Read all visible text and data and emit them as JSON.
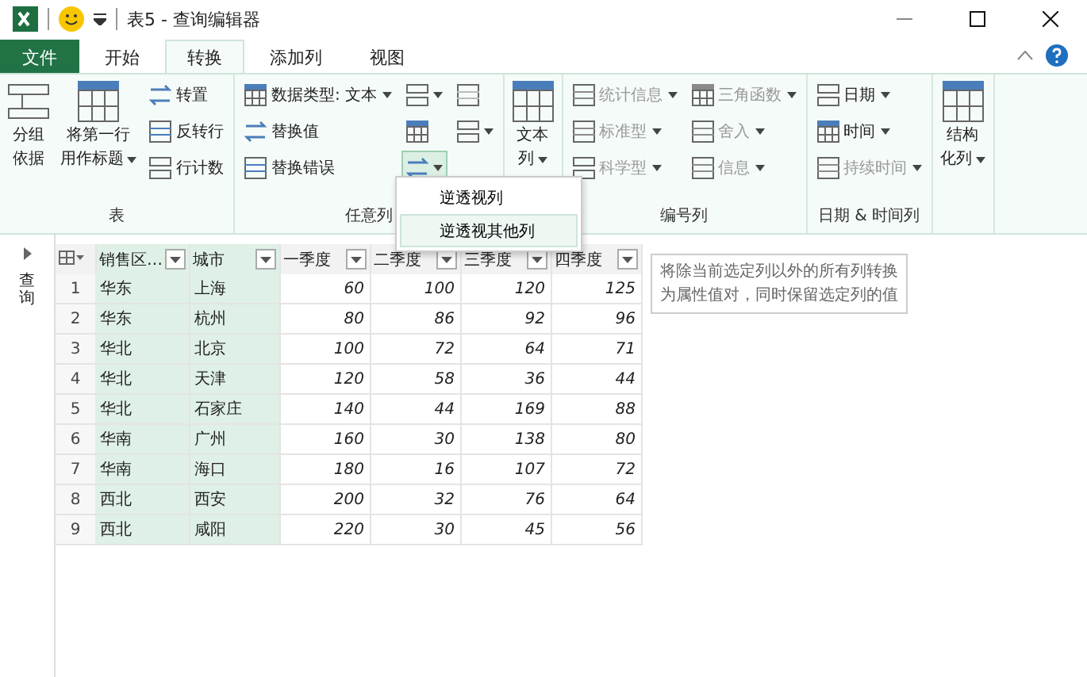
{
  "window": {
    "title": "表5 - 查询编辑器"
  },
  "tabs": [
    {
      "label": "文件",
      "kind": "file",
      "selected": false
    },
    {
      "label": "开始",
      "kind": "tab",
      "selected": false
    },
    {
      "label": "转换",
      "kind": "tab",
      "selected": true
    },
    {
      "label": "添加列",
      "kind": "tab",
      "selected": false
    },
    {
      "label": "视图",
      "kind": "tab",
      "selected": false
    }
  ],
  "ribbon": {
    "groups": [
      {
        "label": "表",
        "columns": [
          [
            {
              "kind": "large",
              "lines": [
                "分组",
                "依据"
              ],
              "dropdown": false,
              "disabled": false
            }
          ],
          [
            {
              "kind": "large",
              "lines": [
                "将第一行",
                "用作标题"
              ],
              "dropdown": true,
              "disabled": false
            }
          ],
          [
            {
              "kind": "small",
              "label": "转置",
              "dropdown": false,
              "disabled": false
            },
            {
              "kind": "small",
              "label": "反转行",
              "dropdown": false,
              "disabled": false
            },
            {
              "kind": "small",
              "label": "行计数",
              "dropdown": false,
              "disabled": false
            }
          ]
        ]
      },
      {
        "label": "任意列",
        "columns": [
          [
            {
              "kind": "small",
              "label": "数据类型: 文本",
              "dropdown": true,
              "disabled": false
            },
            {
              "kind": "small",
              "label": "替换值",
              "dropdown": false,
              "disabled": false
            },
            {
              "kind": "small",
              "label": "替换错误",
              "dropdown": false,
              "disabled": false
            }
          ],
          [
            {
              "kind": "icon",
              "dropdown": true,
              "disabled": false,
              "pressed": false
            },
            {
              "kind": "icon",
              "dropdown": false,
              "disabled": false,
              "pressed": false
            },
            {
              "kind": "icon",
              "dropdown": true,
              "disabled": false,
              "pressed": true
            }
          ],
          [
            {
              "kind": "icon",
              "dropdown": false,
              "disabled": true,
              "pressed": false
            },
            {
              "kind": "icon",
              "dropdown": true,
              "disabled": false,
              "pressed": false
            }
          ]
        ]
      },
      {
        "columns": [
          [
            {
              "kind": "large",
              "lines": [
                "文本",
                "列"
              ],
              "dropdown": true,
              "disabled": false
            }
          ]
        ]
      },
      {
        "label": "编号列",
        "columns": [
          [
            {
              "kind": "small",
              "label": "统计信息",
              "dropdown": true,
              "disabled": true
            },
            {
              "kind": "small",
              "label": "标准型",
              "dropdown": true,
              "disabled": true
            },
            {
              "kind": "small",
              "label": "科学型",
              "dropdown": true,
              "disabled": true
            }
          ],
          [
            {
              "kind": "small",
              "label": "三角函数",
              "dropdown": true,
              "disabled": true
            },
            {
              "kind": "small",
              "label": "舍入",
              "dropdown": true,
              "disabled": true
            },
            {
              "kind": "small",
              "label": "信息",
              "dropdown": true,
              "disabled": true
            }
          ]
        ]
      },
      {
        "label": "日期 & 时间列",
        "columns": [
          [
            {
              "kind": "small",
              "label": "日期",
              "dropdown": true,
              "disabled": false
            },
            {
              "kind": "small",
              "label": "时间",
              "dropdown": true,
              "disabled": false
            },
            {
              "kind": "small",
              "label": "持续时间",
              "dropdown": true,
              "disabled": true
            }
          ]
        ]
      },
      {
        "columns": [
          [
            {
              "kind": "large",
              "lines": [
                "结构",
                "化列"
              ],
              "dropdown": true,
              "disabled": false
            }
          ]
        ]
      }
    ]
  },
  "menu": {
    "items": [
      {
        "label": "逆透视列",
        "selected": false
      },
      {
        "label": "逆透视其他列",
        "selected": true
      }
    ]
  },
  "tooltip": {
    "text": "将除当前选定列以外的所有列转换为属性值对，同时保留选定列的值"
  },
  "queries_pane": {
    "label": "查询"
  },
  "table": {
    "columns": [
      {
        "label": "销售区…",
        "selected": true,
        "numeric": false
      },
      {
        "label": "城市",
        "selected": true,
        "numeric": false
      },
      {
        "label": "一季度",
        "selected": false,
        "numeric": true
      },
      {
        "label": "二季度",
        "selected": false,
        "numeric": true
      },
      {
        "label": "三季度",
        "selected": false,
        "numeric": true
      },
      {
        "label": "四季度",
        "selected": false,
        "numeric": true
      }
    ],
    "rows": [
      {
        "index": "1",
        "cells": [
          "华东",
          "上海",
          "60",
          "100",
          "120",
          "125"
        ]
      },
      {
        "index": "2",
        "cells": [
          "华东",
          "杭州",
          "80",
          "86",
          "92",
          "96"
        ]
      },
      {
        "index": "3",
        "cells": [
          "华北",
          "北京",
          "100",
          "72",
          "64",
          "71"
        ]
      },
      {
        "index": "4",
        "cells": [
          "华北",
          "天津",
          "120",
          "58",
          "36",
          "44"
        ]
      },
      {
        "index": "5",
        "cells": [
          "华北",
          "石家庄",
          "140",
          "44",
          "169",
          "88"
        ]
      },
      {
        "index": "6",
        "cells": [
          "华南",
          "广州",
          "160",
          "30",
          "138",
          "80"
        ]
      },
      {
        "index": "7",
        "cells": [
          "华南",
          "海口",
          "180",
          "16",
          "107",
          "72"
        ]
      },
      {
        "index": "8",
        "cells": [
          "西北",
          "西安",
          "200",
          "32",
          "76",
          "64"
        ]
      },
      {
        "index": "9",
        "cells": [
          "西北",
          "咸阳",
          "220",
          "30",
          "45",
          "56"
        ]
      }
    ]
  }
}
